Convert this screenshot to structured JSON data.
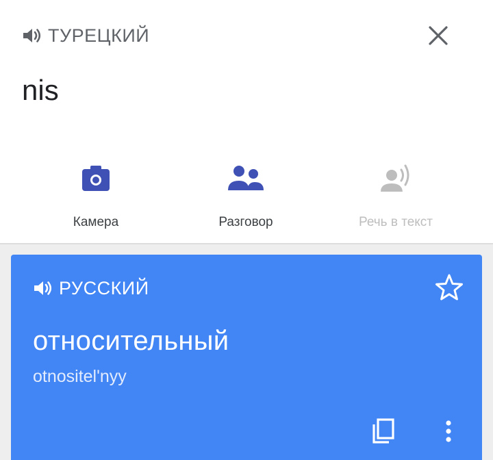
{
  "source": {
    "language_label": "ТУРЕЦКИЙ",
    "text": "nis"
  },
  "tools": {
    "camera_label": "Камера",
    "conversation_label": "Разговор",
    "speech_to_text_label": "Речь в текст"
  },
  "result": {
    "language_label": "РУССКИЙ",
    "translation": "относительный",
    "transliteration": "otnositel'nyy"
  },
  "icons": {
    "speaker": "speaker-icon",
    "close": "close-icon",
    "camera": "camera-icon",
    "conversation": "people-icon",
    "speech": "speech-icon",
    "star": "star-outline-icon",
    "copy": "copy-icon",
    "more": "more-vert-icon"
  },
  "colors": {
    "accent": "#3f51b5",
    "card": "#4285f4",
    "disabled": "#bdbdbd"
  }
}
